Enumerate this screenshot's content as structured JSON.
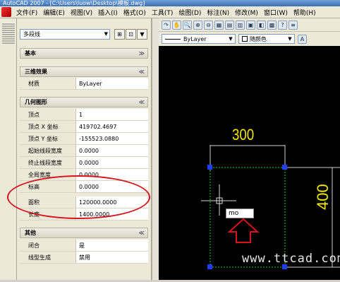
{
  "window": {
    "title": "AutoCAD 2007 - [C:\\Users\\luow\\Desktop\\模板.dwg]"
  },
  "menu": [
    "文件(F)",
    "编辑(E)",
    "视图(V)",
    "插入(I)",
    "格式(O)",
    "工具(T)",
    "绘图(D)",
    "标注(N)",
    "修改(M)",
    "窗口(W)",
    "帮助(H)"
  ],
  "layer_bar": {
    "linetype": "ByLayer",
    "color": "随颜色"
  },
  "properties": {
    "selection": "多段线",
    "sections": {
      "basic": "基本",
      "3d": "三维效果",
      "geometry": "几何图形",
      "misc": "其他"
    },
    "material": {
      "label": "材质",
      "value": "ByLayer"
    },
    "geometry_rows": [
      {
        "label": "顶点",
        "value": "1"
      },
      {
        "label": "顶点 X 坐标",
        "value": "419702.4697"
      },
      {
        "label": "顶点 Y 坐标",
        "value": "-155523.0880"
      },
      {
        "label": "起始线段宽度",
        "value": "0.0000"
      },
      {
        "label": "终止线段宽度",
        "value": "0.0000"
      },
      {
        "label": "全局宽度",
        "value": "0.0000"
      },
      {
        "label": "标高",
        "value": "0.0000"
      },
      {
        "label": "面积",
        "value": "120000.0000"
      },
      {
        "label": "长度",
        "value": "1400.0000"
      }
    ],
    "misc_rows": [
      {
        "label": "闭合",
        "value": "是"
      },
      {
        "label": "线型生成",
        "value": "禁用"
      }
    ]
  },
  "drawing": {
    "dim_top": "300",
    "dim_right": "400",
    "input_text": "mo",
    "watermark": "www.ttcad.com"
  },
  "colors": {
    "dimension": "#f2e600",
    "grip": "#1f3cff",
    "dashed": "#20d020",
    "red_mark": "#d5141c"
  }
}
